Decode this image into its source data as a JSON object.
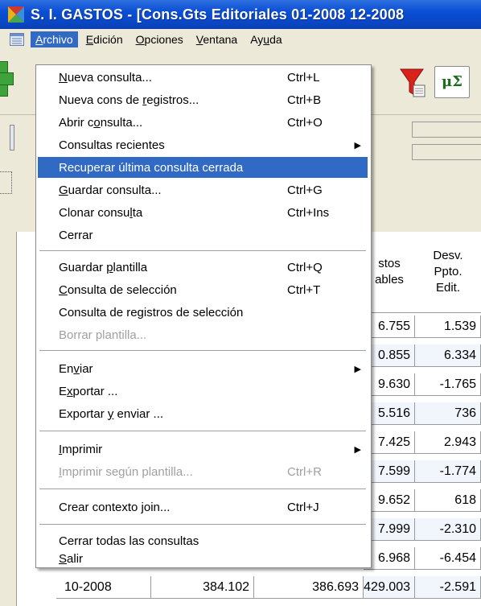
{
  "window": {
    "title": "S. I. GASTOS - [Cons.Gts Editoriales 01-2008 12-2008"
  },
  "menubar": {
    "items": [
      {
        "label": "Archivo",
        "u": "A",
        "rest": "rchivo"
      },
      {
        "label": "Edición",
        "u": "E",
        "rest": "dición"
      },
      {
        "label": "Opciones",
        "u": "O",
        "rest": "pciones"
      },
      {
        "label": "Ventana",
        "u": "V",
        "rest": "entana"
      },
      {
        "label": "Ayuda",
        "pre": "Ay",
        "u": "u",
        "rest": "da"
      }
    ]
  },
  "archivo_menu": {
    "items": [
      {
        "pre": "",
        "u": "N",
        "post": "ueva consulta...",
        "shortcut": "Ctrl+L"
      },
      {
        "pre": "Nueva cons de ",
        "u": "r",
        "post": "egistros...",
        "shortcut": "Ctrl+B"
      },
      {
        "pre": "Abrir c",
        "u": "o",
        "post": "nsulta...",
        "shortcut": "Ctrl+O"
      },
      {
        "pre": "Consultas recientes",
        "u": "",
        "post": "",
        "shortcut": "",
        "submenu": "▶"
      },
      {
        "pre": "Recuperar última consulta cerrada",
        "u": "",
        "post": "",
        "shortcut": ""
      },
      {
        "pre": "",
        "u": "G",
        "post": "uardar consulta...",
        "shortcut": "Ctrl+G"
      },
      {
        "pre": "Clonar consu",
        "u": "l",
        "post": "ta",
        "shortcut": "Ctrl+Ins"
      },
      {
        "pre": "Cerrar",
        "u": "",
        "post": "",
        "shortcut": ""
      },
      {
        "pre": "Guardar ",
        "u": "p",
        "post": "lantilla",
        "shortcut": "Ctrl+Q"
      },
      {
        "pre": "",
        "u": "C",
        "post": "onsulta de selección",
        "shortcut": "Ctrl+T"
      },
      {
        "pre": "Consulta de registros de selección",
        "u": "",
        "post": "",
        "shortcut": ""
      },
      {
        "pre": "Borrar plantilla...",
        "u": "",
        "post": "",
        "shortcut": ""
      },
      {
        "pre": "En",
        "u": "v",
        "post": "iar",
        "shortcut": "",
        "submenu": "▶"
      },
      {
        "pre": "E",
        "u": "x",
        "post": "portar ...",
        "shortcut": ""
      },
      {
        "pre": "Exportar ",
        "u": "y",
        "post": " enviar ...",
        "shortcut": ""
      },
      {
        "pre": "",
        "u": "I",
        "post": "mprimir",
        "shortcut": "",
        "submenu": "▶"
      },
      {
        "pre": "",
        "u": "I",
        "post": "mprimir según plantilla...",
        "shortcut": "Ctrl+R"
      },
      {
        "pre": "Crear contexto join...",
        "u": "",
        "post": "",
        "shortcut": "Ctrl+J"
      },
      {
        "pre": "Cerrar todas las consultas",
        "u": "",
        "post": "",
        "shortcut": ""
      },
      {
        "pre": "",
        "u": "S",
        "post": "alir",
        "shortcut": ""
      }
    ]
  },
  "grid": {
    "header_col3": "stos\nables",
    "header_col4": "Desv.\nPpto.\nEdit.",
    "col3": [
      "6.755",
      "0.855",
      "9.630",
      "5.516",
      "7.425",
      "7.599",
      "9.652",
      "7.999",
      "6.968",
      "429.003"
    ],
    "col4": [
      "1.539",
      "6.334",
      "-1.765",
      "736",
      "2.943",
      "-1.774",
      "618",
      "-2.310",
      "-6.454",
      "-2.591"
    ],
    "last_row": {
      "period": "10-2008",
      "col1": "384.102",
      "col2": "386.693"
    }
  },
  "toolbar": {
    "mu_symbol": "μΣ"
  }
}
